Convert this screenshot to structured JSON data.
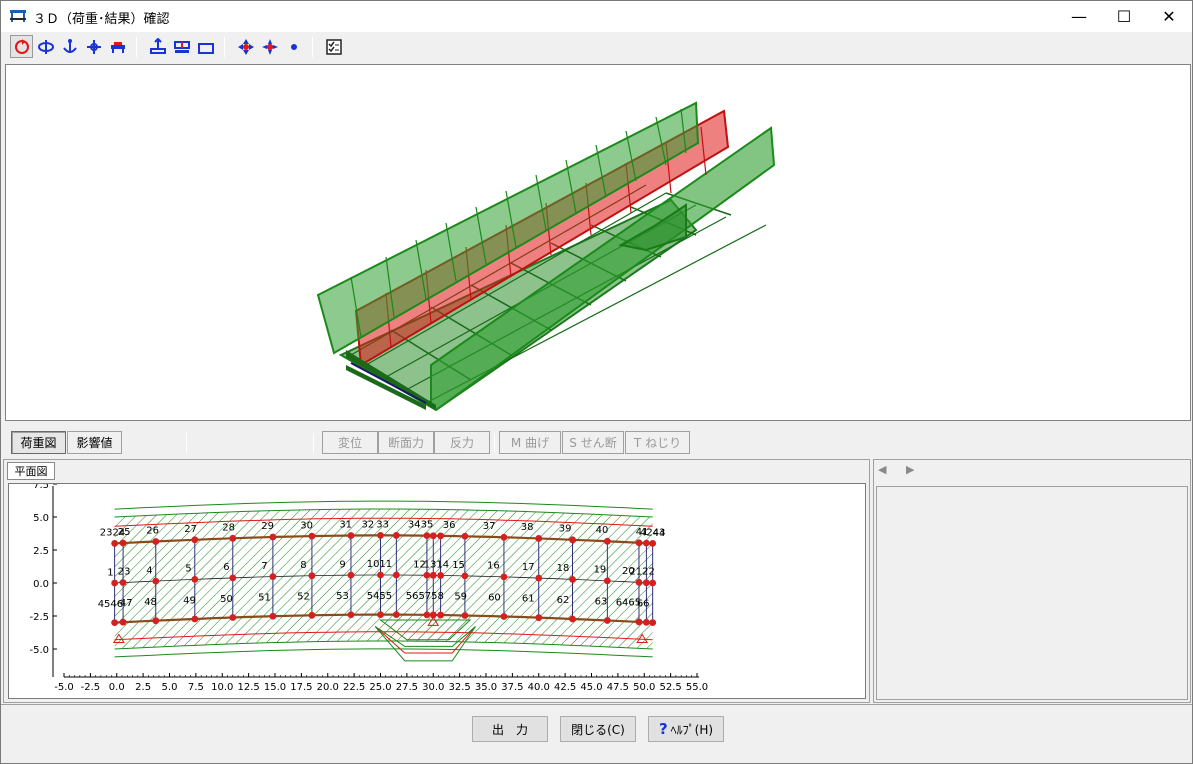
{
  "window": {
    "title": "３Ｄ（荷重･結果）確認",
    "minimize_label": "—",
    "maximize_label": "☐",
    "close_label": "✕"
  },
  "toolbar": {
    "buttons": [
      {
        "icon": "rotate-icon"
      },
      {
        "icon": "rotate-axis-icon"
      },
      {
        "icon": "anchor-icon"
      },
      {
        "icon": "move-icon"
      },
      {
        "icon": "view-front-icon"
      },
      {
        "icon": "load-view-icon"
      },
      {
        "icon": "load-distributed-icon"
      },
      {
        "icon": "section-icon"
      },
      {
        "icon": "node-cross-icon"
      },
      {
        "icon": "node-star-icon"
      },
      {
        "icon": "dot-icon"
      },
      {
        "icon": "checklist-icon"
      }
    ]
  },
  "tabs": {
    "load_diagram": "荷重図",
    "influence_value": "影響値",
    "displacement": "変位",
    "section_force": "断面力",
    "reaction": "反力",
    "moment": "M 曲げ",
    "shear": "S せん断",
    "torsion": "T ねじり"
  },
  "plan_view": {
    "tab_label": "平面図",
    "y_ticks": [
      "7.5",
      "5.0",
      "2.5",
      "0.0",
      "-2.5",
      "-5.0"
    ],
    "x_ticks": [
      "-5.0",
      "-2.5",
      "0.0",
      "2.5",
      "5.0",
      "7.5",
      "10.0",
      "12.5",
      "15.0",
      "17.5",
      "20.0",
      "22.5",
      "25.0",
      "27.5",
      "30.0",
      "32.5",
      "35.0",
      "37.5",
      "40.0",
      "42.5",
      "45.0",
      "47.5",
      "50.0",
      "52.5",
      "55.0"
    ],
    "top_labels": [
      "2324",
      "25",
      "26",
      "27",
      "28",
      "29",
      "30",
      "31",
      "32",
      "33",
      "3435",
      "36",
      "37",
      "38",
      "39",
      "40",
      "41",
      "4243",
      "44"
    ],
    "mid_labels": [
      "1",
      "23",
      "4",
      "5",
      "6",
      "7",
      "8",
      "9",
      "10",
      "11",
      "12",
      "1314",
      "15",
      "16",
      "17",
      "18",
      "19",
      "20",
      "2122"
    ],
    "bottom_labels": [
      "4546",
      "47",
      "48",
      "49",
      "50",
      "51",
      "52",
      "53",
      "54",
      "55",
      "5657",
      "58",
      "59",
      "60",
      "61",
      "62",
      "63",
      "6465",
      "66"
    ]
  },
  "side_panel": {
    "nav_prev": "◀",
    "nav_next": "▶"
  },
  "footer": {
    "output_label": "出　力",
    "close_label": "閉じる(C)",
    "help_label": "ﾍﾙﾌﾟ(H)"
  },
  "colors": {
    "green": "#1a8a1a",
    "red": "#e01818",
    "node_red": "#d42020",
    "blue_icon": "#1a33d6"
  }
}
